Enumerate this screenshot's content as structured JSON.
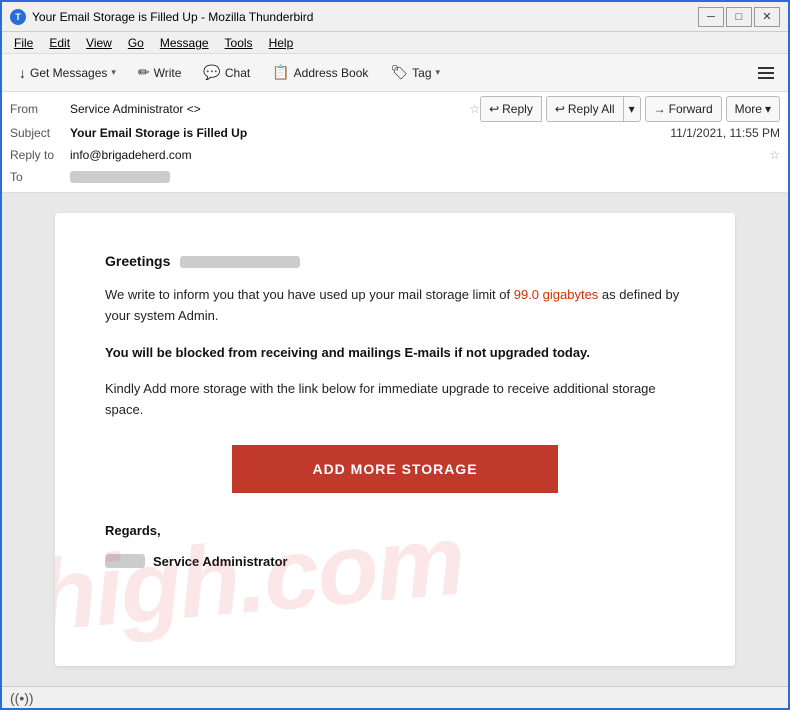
{
  "window": {
    "title": "Your Email Storage is Filled Up - Mozilla Thunderbird",
    "icon": "T"
  },
  "titlebar": {
    "minimize": "─",
    "maximize": "□",
    "close": "✕"
  },
  "menubar": {
    "items": [
      "File",
      "Edit",
      "View",
      "Go",
      "Message",
      "Tools",
      "Help"
    ]
  },
  "toolbar": {
    "get_messages_label": "Get Messages",
    "write_label": "Write",
    "chat_label": "Chat",
    "address_book_label": "Address Book",
    "tag_label": "Tag",
    "hamburger": "≡"
  },
  "email_header": {
    "from_label": "From",
    "from_value": "Service Administrator <>",
    "subject_label": "Subject",
    "subject_value": "Your Email Storage is Filled Up",
    "date_value": "11/1/2021, 11:55 PM",
    "reply_to_label": "Reply to",
    "reply_to_value": "info@brigadeherd.com",
    "to_label": "To"
  },
  "action_buttons": {
    "reply": "Reply",
    "reply_all": "Reply All",
    "forward": "Forward",
    "more": "More"
  },
  "email_body": {
    "greeting": "Greetings",
    "para1_pre": "We write to inform you that you have used up your mail storage limit of ",
    "para1_highlight": "99.0 gigabytes",
    "para1_post": " as defined by your system Admin.",
    "para2": "You will be blocked from receiving and mailings E-mails if not upgraded today.",
    "para3": "Kindly Add more storage with the link below for immediate upgrade to receive additional storage space.",
    "cta_label": "ADD MORE STORAGE",
    "regards": "Regards,",
    "signature_name": "Service Administrator",
    "watermark": "high.com"
  },
  "statusbar": {
    "wifi_icon": "((•))"
  }
}
